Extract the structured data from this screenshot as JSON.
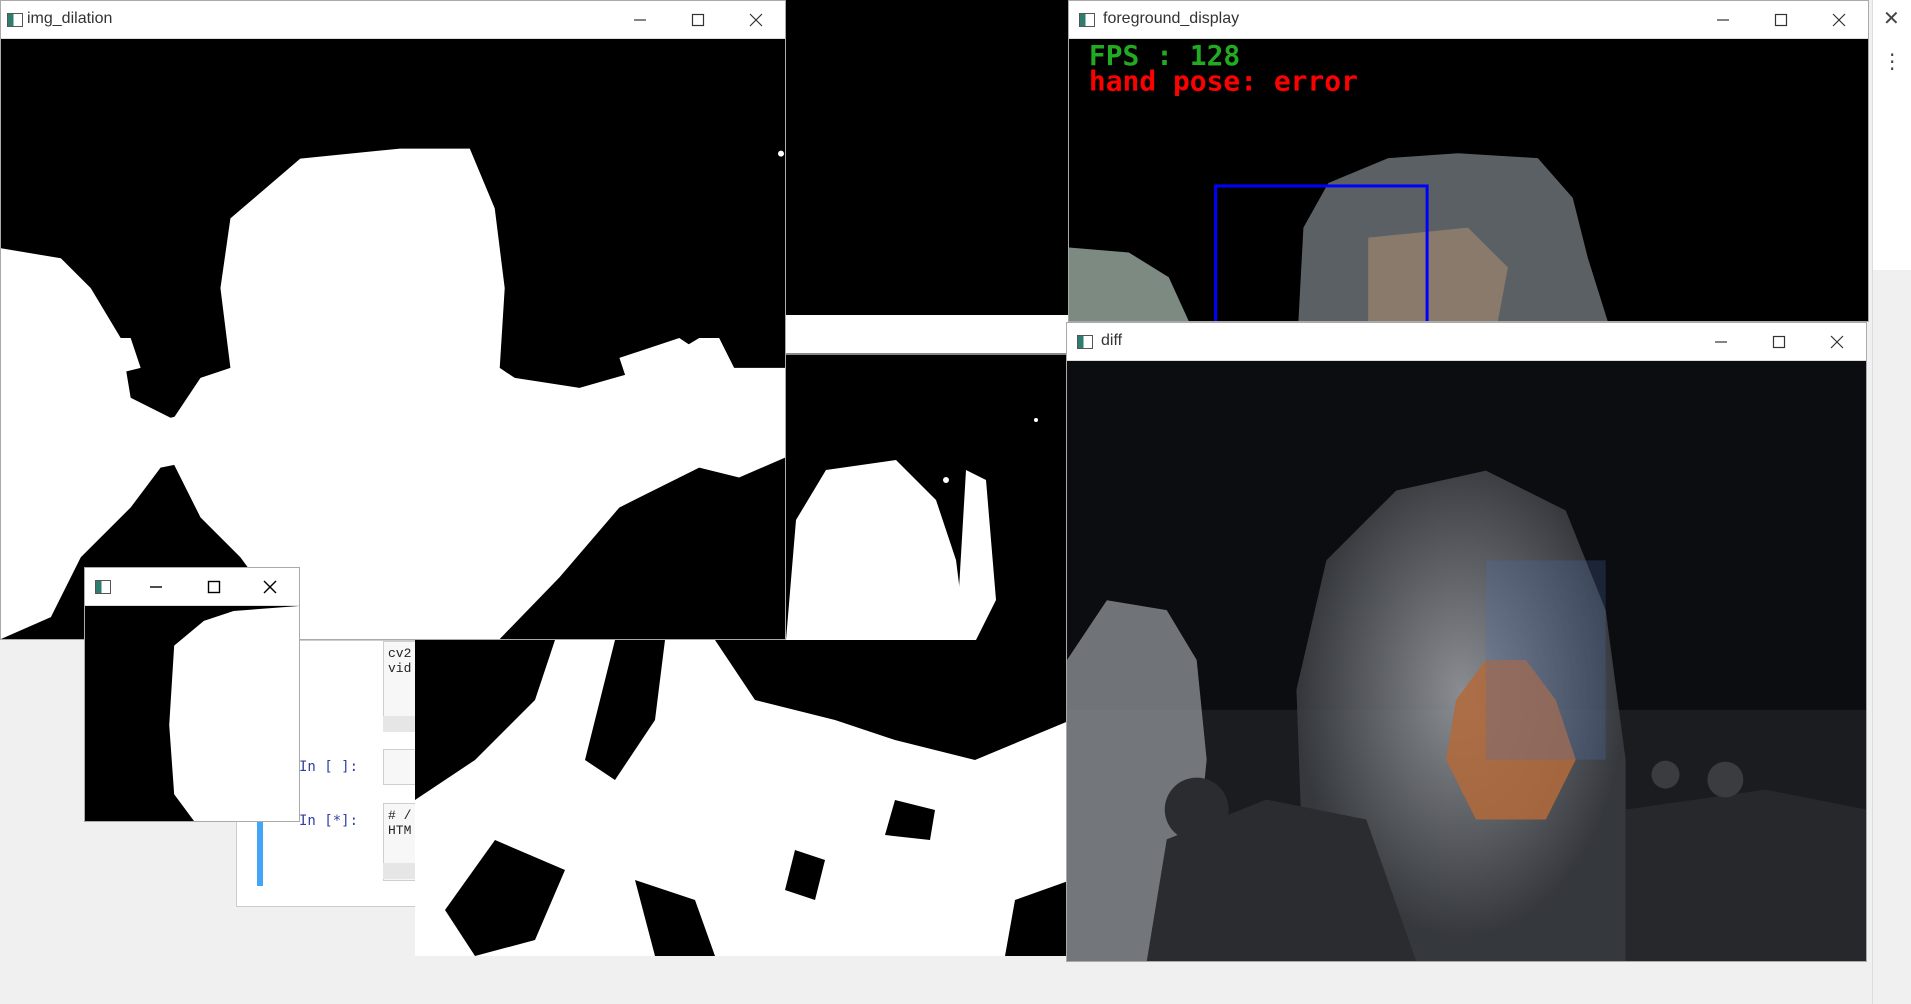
{
  "windows": {
    "img_dilation": {
      "title": "img_dilation"
    },
    "foreground_display": {
      "title": "foreground_display",
      "overlay": {
        "fps_text": "FPS : 128",
        "pose_text": "hand pose: error",
        "fps_color": "#22aa22",
        "pose_color": "#ff0000",
        "box_color": "#0000ff"
      }
    },
    "diff": {
      "title": "diff"
    },
    "small": {
      "title": ""
    },
    "mask": {
      "title": ""
    }
  },
  "notebook": {
    "cell1_code": "cv2\nvid",
    "cell2_prompt": "In [ ]:",
    "cell3_prompt": "In [*]:",
    "cell3_code": "# /\nHTM"
  },
  "icons": [
    "minimize-icon",
    "maximize-icon",
    "close-icon",
    "app-icon",
    "more-vert-icon"
  ]
}
